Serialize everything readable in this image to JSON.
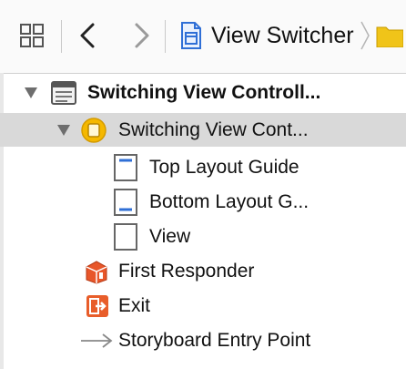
{
  "toolbar": {
    "icons": [
      "related-items-icon",
      "back-icon",
      "forward-icon",
      "storyboard-file-icon",
      "chevron-right-icon",
      "folder-icon"
    ],
    "breadcrumb_label": "View Switcher"
  },
  "outline": {
    "scene_label": "Switching View Controll...",
    "view_controller_label": "Switching View Cont...",
    "children": [
      {
        "label": "Top Layout Guide",
        "icon": "top-layout-guide-icon"
      },
      {
        "label": "Bottom Layout G...",
        "icon": "bottom-layout-guide-icon"
      },
      {
        "label": "View",
        "icon": "view-icon"
      }
    ],
    "first_responder_label": "First Responder",
    "exit_label": "Exit",
    "entry_point_label": "Storyboard Entry Point",
    "colors": {
      "selection": "#d9d9d9",
      "view_controller_yellow": "#f5b800",
      "first_responder_orange": "#e8572a",
      "exit_orange": "#e85d2a",
      "file_blue": "#2f6fd6",
      "folder_yellow": "#f0c419"
    }
  }
}
